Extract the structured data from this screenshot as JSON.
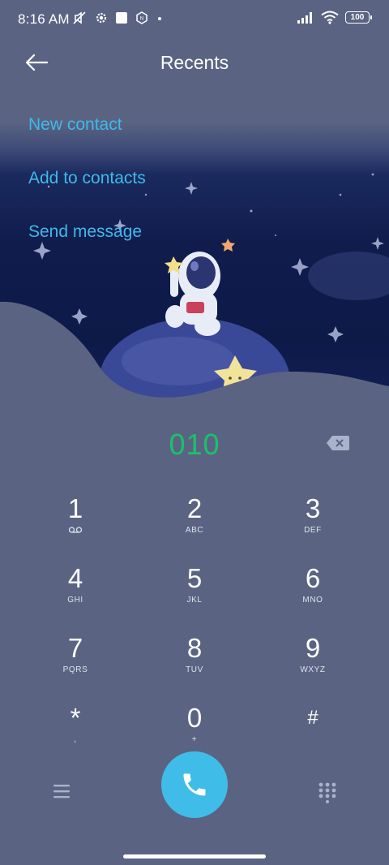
{
  "status_bar": {
    "time": "8:16 AM",
    "battery": "100",
    "left_icons": [
      "mute-icon",
      "settings-icon",
      "square-icon",
      "nfc-icon",
      "dot-icon"
    ],
    "right_icons": [
      "signal-icon",
      "wifi-icon",
      "battery-icon"
    ]
  },
  "header": {
    "title": "Recents",
    "back_icon": "back-arrow-icon"
  },
  "menu": {
    "items": [
      {
        "label": "New contact"
      },
      {
        "label": "Add to contacts"
      },
      {
        "label": "Send message"
      }
    ]
  },
  "dialer": {
    "number": "010",
    "number_color": "#1bc16a",
    "backspace_icon": "backspace-icon"
  },
  "keypad": {
    "keys": [
      {
        "digit": "1",
        "letters": ""
      },
      {
        "digit": "2",
        "letters": "ABC"
      },
      {
        "digit": "3",
        "letters": "DEF"
      },
      {
        "digit": "4",
        "letters": "GHI"
      },
      {
        "digit": "5",
        "letters": "JKL"
      },
      {
        "digit": "6",
        "letters": "MNO"
      },
      {
        "digit": "7",
        "letters": "PQRS"
      },
      {
        "digit": "8",
        "letters": "TUV"
      },
      {
        "digit": "9",
        "letters": "WXYZ"
      },
      {
        "digit": "*",
        "letters": ","
      },
      {
        "digit": "0",
        "letters": "+"
      },
      {
        "digit": "#",
        "letters": ""
      }
    ]
  },
  "bottom_bar": {
    "menu_icon": "hamburger-menu-icon",
    "call_icon": "phone-icon",
    "dialpad_icon": "dialpad-icon",
    "call_color": "#3fbde8"
  },
  "colors": {
    "background": "#5a6482",
    "accent": "#3fb9ea"
  }
}
